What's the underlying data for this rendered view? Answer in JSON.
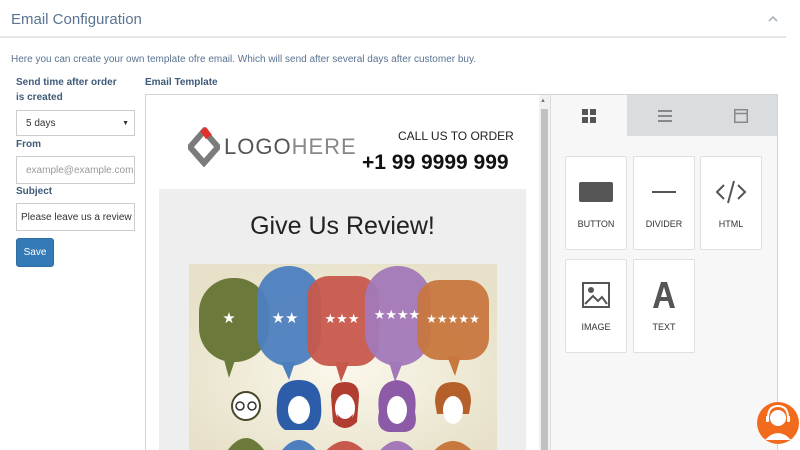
{
  "header": {
    "title": "Email Configuration",
    "collapse_icon": "chevron-up-icon"
  },
  "description": "Here you can create your own template ofre email. Which will send after several days after customer buy.",
  "form": {
    "send_time_label": "Send time after order is created",
    "send_time_value": "5 days",
    "from_label": "From",
    "from_placeholder": "example@example.com",
    "subject_label": "Subject",
    "subject_value": "Please leave us a review",
    "save_label": "Save"
  },
  "template": {
    "label": "Email Template",
    "logo_text_bold": "LOGO",
    "logo_text_light": "HERE",
    "call_label": "CALL US TO ORDER",
    "phone": "+1 99 9999 999",
    "review_title": "Give Us Review!",
    "stars": [
      "★",
      "★★",
      "★★★",
      "★★★★",
      "★★★★★"
    ]
  },
  "panel": {
    "tabs": [
      {
        "name": "content",
        "icon": "grid-icon",
        "active": true
      },
      {
        "name": "rows",
        "icon": "rows-icon",
        "active": false
      },
      {
        "name": "body",
        "icon": "layout-icon",
        "active": false
      }
    ],
    "tools": [
      {
        "label": "BUTTON",
        "icon": "button-icon"
      },
      {
        "label": "DIVIDER",
        "icon": "divider-icon"
      },
      {
        "label": "HTML",
        "icon": "code-icon"
      },
      {
        "label": "IMAGE",
        "icon": "image-icon"
      },
      {
        "label": "TEXT",
        "icon": "text-icon"
      }
    ]
  },
  "colors": {
    "accent": "#337ab7",
    "support": "#f26b1d",
    "bubble_green": "#6b7a3a",
    "bubble_blue": "#4d7fbf",
    "bubble_red": "#c7584c",
    "bubble_purple": "#a278b8",
    "bubble_orange": "#c8773e"
  },
  "chat_icon": "support-agent-icon"
}
